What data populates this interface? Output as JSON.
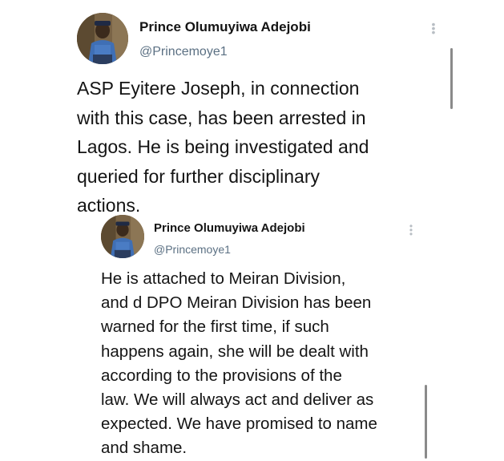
{
  "tweets": [
    {
      "author_name": "Prince Olumuyiwa Adejobi",
      "handle": "@Princemoye1",
      "lines": [
        "ASP Eyitere Joseph, in connection",
        "with this case, has been arrested in",
        "Lagos. He is being investigated and",
        "queried for further disciplinary",
        "actions."
      ],
      "more_icon": "more-vertical-icon"
    },
    {
      "author_name": "Prince Olumuyiwa Adejobi",
      "handle": "@Princemoye1",
      "lines": [
        "He is attached to Meiran Division,",
        "and d DPO Meiran Division has been",
        "warned for the first time, if such",
        "happens again, she will be dealt with",
        "according to the provisions of the",
        "law. We will always act and deliver as",
        "expected. We have promised to name",
        "and shame."
      ],
      "more_icon": "more-vertical-icon"
    }
  ]
}
